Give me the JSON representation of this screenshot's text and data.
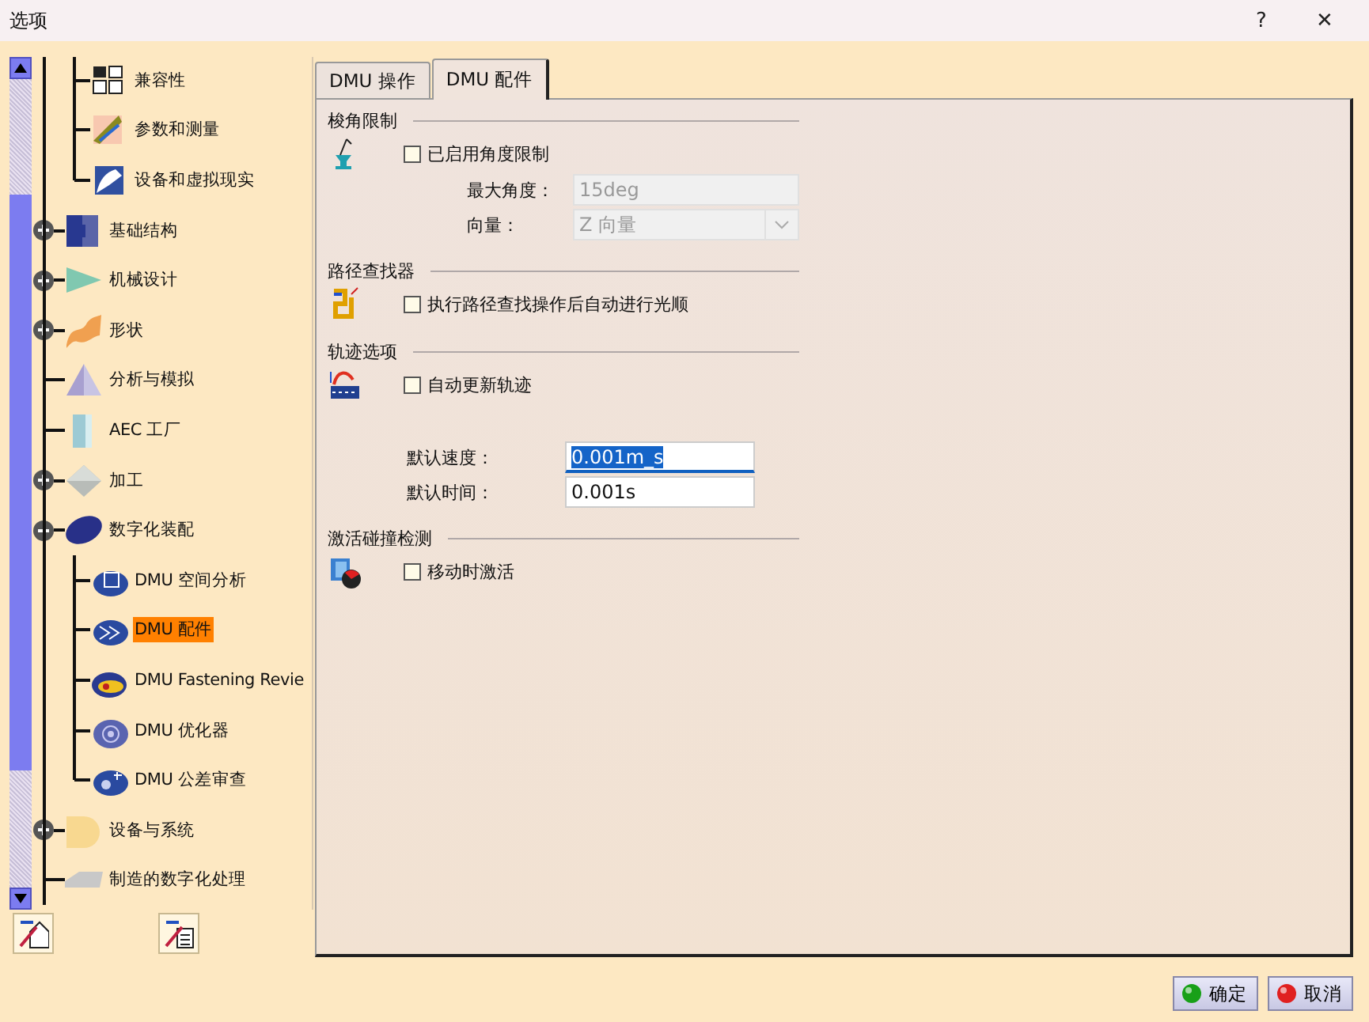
{
  "window": {
    "title": "选项",
    "help": "?",
    "close": "✕"
  },
  "tree": {
    "scrolled_parent_children": [
      {
        "label": "兼容性",
        "selected": false
      },
      {
        "label": "参数和测量",
        "selected": false
      },
      {
        "label": "设备和虚拟现实",
        "selected": false
      }
    ],
    "items": [
      {
        "label": "基础结构",
        "expanded": false,
        "selected": false
      },
      {
        "label": "机械设计",
        "expanded": false,
        "selected": false
      },
      {
        "label": "形状",
        "expanded": false,
        "selected": false
      },
      {
        "label": "分析与模拟",
        "selected": false
      },
      {
        "label": "AEC 工厂",
        "selected": false
      },
      {
        "label": "加工",
        "expanded": false,
        "selected": false
      },
      {
        "label": "数字化装配",
        "expanded": true,
        "selected": false,
        "children": [
          {
            "label": "DMU 空间分析",
            "selected": false
          },
          {
            "label": "DMU 配件",
            "selected": true
          },
          {
            "label": "DMU Fastening Revie",
            "selected": false
          },
          {
            "label": "DMU 优化器",
            "selected": false
          },
          {
            "label": "DMU 公差审查",
            "selected": false
          }
        ]
      },
      {
        "label": "设备与系统",
        "expanded": false,
        "selected": false
      },
      {
        "label": "制造的数字化处理",
        "selected": false
      }
    ]
  },
  "tabs": [
    {
      "label": "DMU 操作",
      "selected": false
    },
    {
      "label": "DMU 配件",
      "selected": true
    }
  ],
  "sections": [
    {
      "title": "梭角限制",
      "checkbox": {
        "label": "已启用角度限制",
        "checked": false
      },
      "fields": [
        {
          "kind": "text",
          "label": "最大角度：",
          "value": "15deg",
          "disabled": true,
          "focused": false
        },
        {
          "kind": "dropdown",
          "label": "向量：",
          "value": "Z 向量",
          "disabled": true,
          "focused": false
        }
      ]
    },
    {
      "title": "路径查找器",
      "checkbox": {
        "label": "执行路径查找操作后自动进行光顺",
        "checked": false
      }
    },
    {
      "title": "轨迹选项",
      "checkbox": {
        "label": "自动更新轨迹",
        "checked": false
      },
      "fields": [
        {
          "kind": "text",
          "label": "默认速度：",
          "value": "0.001m_s",
          "disabled": false,
          "focused": true
        },
        {
          "kind": "text",
          "label": "默认时间：",
          "value": "0.001s",
          "disabled": false,
          "focused": false
        }
      ]
    },
    {
      "title": "激活碰撞检测",
      "checkbox": {
        "label": "移动时激活",
        "checked": false
      }
    }
  ],
  "buttons": [
    {
      "kind": "ok",
      "label": "确定"
    },
    {
      "kind": "cancel",
      "label": "取消"
    }
  ]
}
